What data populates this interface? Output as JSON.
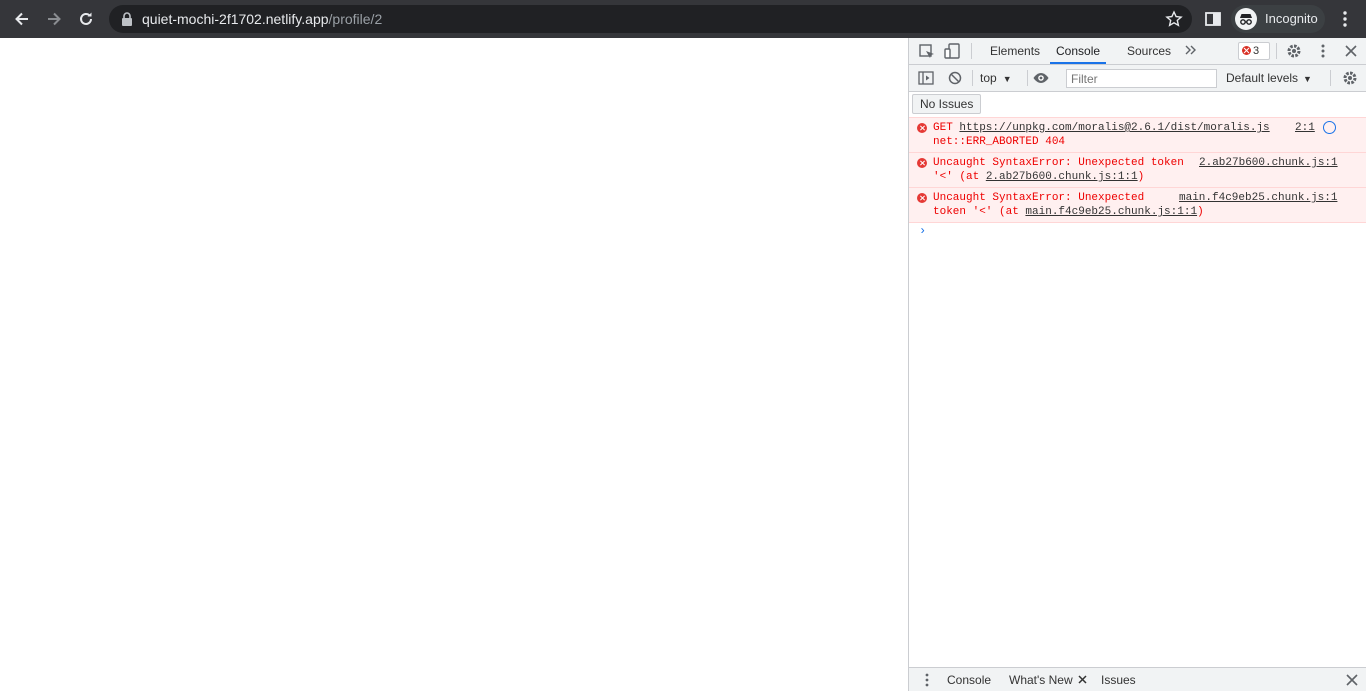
{
  "browser": {
    "url_host": "quiet-mochi-2f1702.netlify.app",
    "url_path": "/profile/2",
    "profile_label": "Incognito"
  },
  "devtools": {
    "tabs": [
      "Elements",
      "Console",
      "Sources"
    ],
    "active_tab": "Console",
    "error_count": "3",
    "context": "top",
    "filter_placeholder": "Filter",
    "levels": "Default levels",
    "issues_button": "No Issues",
    "messages": [
      {
        "line1_prefix": "GET ",
        "line1_link": "https://unpkg.com/moralis@2.6.1/dist/moralis.js",
        "line2": "net::ERR_ABORTED 404",
        "source": "2:1"
      },
      {
        "line1": "Uncaught SyntaxError: Unexpected token",
        "line2_prefix": "'<' (at ",
        "line2_link": "2.ab27b600.chunk.js:1:1",
        "line2_suffix": ")",
        "source": "2.ab27b600.chunk.js:1"
      },
      {
        "line1": "Uncaught SyntaxError: Unexpected",
        "line2_prefix": "token '<' (at ",
        "line2_link": "main.f4c9eb25.chunk.js:1:1",
        "line2_suffix": ")",
        "source": "main.f4c9eb25.chunk.js:1"
      }
    ],
    "drawer_tabs": [
      "Console",
      "What's New",
      "Issues"
    ]
  },
  "colors": {
    "toolbar_bg": "#35363a",
    "omnibox_bg": "#202124",
    "error_text": "#ee0000",
    "error_bg": "#fff0f0",
    "accent": "#1a73e8"
  }
}
